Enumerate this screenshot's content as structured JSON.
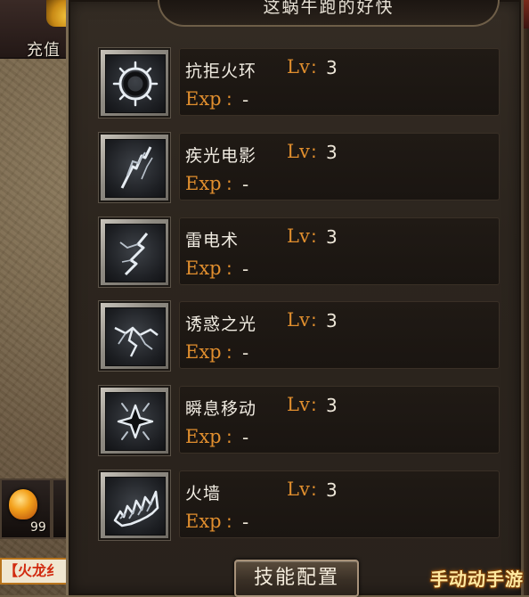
{
  "hud": {
    "charge_label": "充值",
    "potion_count": "99",
    "bottom_tag": "【火龙纟"
  },
  "panel": {
    "title": "这蜗牛跑的好快",
    "config_button": "技能配置"
  },
  "skills": [
    {
      "name": "抗拒火环",
      "lv_label": "Lv",
      "lv": "3",
      "exp_label": "Exp",
      "exp": "-",
      "icon": "ring-of-fire-icon"
    },
    {
      "name": "疾光电影",
      "lv_label": "Lv",
      "lv": "3",
      "exp_label": "Exp",
      "exp": "-",
      "icon": "lightning-bolt-icon"
    },
    {
      "name": "雷电术",
      "lv_label": "Lv",
      "lv": "3",
      "exp_label": "Exp",
      "exp": "-",
      "icon": "thunder-icon"
    },
    {
      "name": "诱惑之光",
      "lv_label": "Lv",
      "lv": "3",
      "exp_label": "Exp",
      "exp": "-",
      "icon": "lure-light-icon"
    },
    {
      "name": "瞬息移动",
      "lv_label": "Lv",
      "lv": "3",
      "exp_label": "Exp",
      "exp": "-",
      "icon": "teleport-icon"
    },
    {
      "name": "火墙",
      "lv_label": "Lv",
      "lv": "3",
      "exp_label": "Exp",
      "exp": "-",
      "icon": "fire-wall-icon"
    }
  ],
  "separator": ":",
  "watermark": "手动动手游",
  "colors": {
    "accent_orange": "#e08e2e",
    "text_light": "#f1ece2",
    "panel_bg": "#2c251e"
  }
}
